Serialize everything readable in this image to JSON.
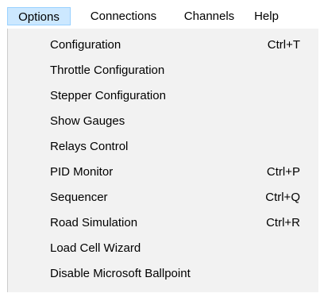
{
  "menubar": {
    "items": [
      {
        "label": "Options",
        "active": true
      },
      {
        "label": "Connections"
      },
      {
        "label": "Channels"
      },
      {
        "label": "Help"
      }
    ]
  },
  "options_menu": {
    "items": [
      {
        "label": "Configuration",
        "shortcut": "Ctrl+T"
      },
      {
        "label": "Throttle Configuration",
        "shortcut": ""
      },
      {
        "label": "Stepper Configuration",
        "shortcut": ""
      },
      {
        "label": "Show Gauges",
        "shortcut": ""
      },
      {
        "label": "Relays Control",
        "shortcut": ""
      },
      {
        "label": "PID Monitor",
        "shortcut": "Ctrl+P"
      },
      {
        "label": "Sequencer",
        "shortcut": "Ctrl+Q"
      },
      {
        "label": "Road Simulation",
        "shortcut": "Ctrl+R"
      },
      {
        "label": "Load Cell Wizard",
        "shortcut": ""
      },
      {
        "label": "Disable Microsoft Ballpoint",
        "shortcut": ""
      }
    ]
  },
  "colors": {
    "menubar_background": "#ffffff",
    "active_highlight": "#cce8ff",
    "active_border": "#99d1ff",
    "dropdown_background": "#f2f2f2"
  }
}
